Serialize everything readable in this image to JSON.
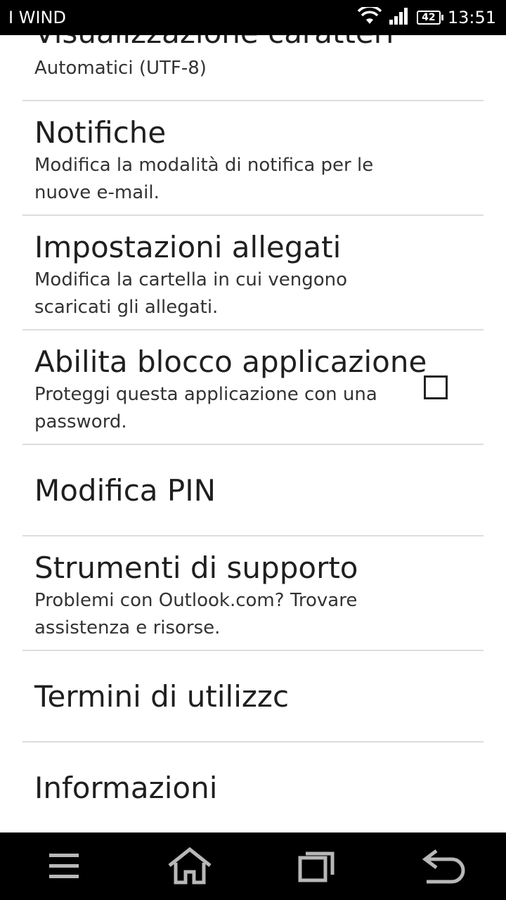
{
  "status_bar": {
    "carrier": "I WIND",
    "battery": "42",
    "time": "13:51",
    "icons": [
      "wifi-icon",
      "signal-icon",
      "battery-icon"
    ]
  },
  "settings": {
    "items": [
      {
        "title": "Visualizzazione caratteri",
        "desc": "Automatici (UTF-8)"
      },
      {
        "title": "Notifiche",
        "desc": "Modifica la modalità di notifica per le nuove e-mail."
      },
      {
        "title": "Impostazioni allegati",
        "desc": "Modifica la cartella in cui vengono scaricati gli allegati."
      },
      {
        "title": "Abilita blocco applicazione",
        "desc": "Proteggi questa applicazione con una password.",
        "checked": false
      },
      {
        "title": "Modifica PIN"
      },
      {
        "title": "Strumenti di supporto",
        "desc": "Problemi con Outlook.com? Trovare assistenza e risorse."
      },
      {
        "title": "Termini di utilizzc"
      },
      {
        "title": "Informazioni"
      }
    ]
  },
  "nav_bar": {
    "buttons": [
      "menu-icon",
      "home-icon",
      "recent-apps-icon",
      "back-icon"
    ]
  },
  "colors": {
    "bars": "#000000",
    "background": "#ffffff",
    "divider": "#dddddd",
    "text": "#1f1f1f"
  }
}
